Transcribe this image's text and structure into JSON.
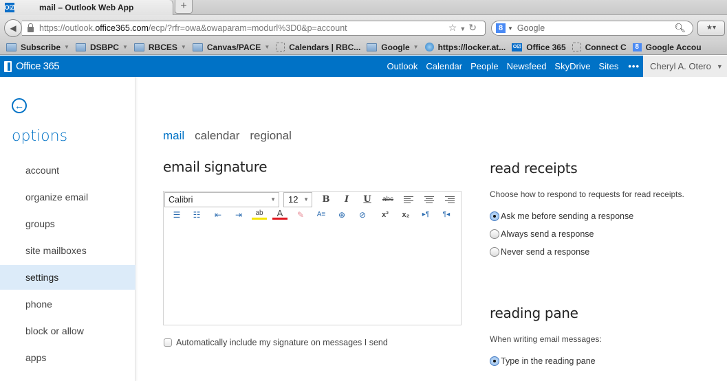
{
  "browser": {
    "tab_title": "mail – Outlook Web App",
    "tab_favicon": "O☑",
    "new_tab": "+",
    "url_prefix": "https://outlook.",
    "url_domain": "office365.com",
    "url_suffix": "/ecp/?rfr=owa&owaparam=modurl%3D0&p=account",
    "search_placeholder": "Google",
    "bookmarks": [
      {
        "label": "Subscribe",
        "icon": "folder-icon",
        "dropdown": true
      },
      {
        "label": "DSBPC",
        "icon": "folder-icon",
        "dropdown": true
      },
      {
        "label": "RBCES",
        "icon": "folder-icon",
        "dropdown": true
      },
      {
        "label": "Canvas/PACE",
        "icon": "folder-icon",
        "dropdown": true
      },
      {
        "label": "Calendars | RBC...",
        "icon": "page-icon",
        "dropdown": false
      },
      {
        "label": "Google",
        "icon": "folder-icon",
        "dropdown": true
      },
      {
        "label": "https://locker.at...",
        "icon": "att-globe-icon",
        "dropdown": false
      },
      {
        "label": "Office 365",
        "icon": "outlook-icon",
        "dropdown": false
      },
      {
        "label": "Connect C",
        "icon": "page-icon",
        "dropdown": false
      },
      {
        "label": "Google Accou",
        "icon": "google-icon",
        "dropdown": false
      }
    ]
  },
  "header": {
    "brand": "Office 365",
    "nav": [
      "Outlook",
      "Calendar",
      "People",
      "Newsfeed",
      "SkyDrive",
      "Sites"
    ],
    "more": "•••",
    "user": "Cheryl A. Otero"
  },
  "sidebar": {
    "title": "options",
    "items": [
      {
        "label": "account",
        "active": false
      },
      {
        "label": "organize email",
        "active": false
      },
      {
        "label": "groups",
        "active": false
      },
      {
        "label": "site mailboxes",
        "active": false
      },
      {
        "label": "settings",
        "active": true
      },
      {
        "label": "phone",
        "active": false
      },
      {
        "label": "block or allow",
        "active": false
      },
      {
        "label": "apps",
        "active": false
      }
    ]
  },
  "main": {
    "tabs": [
      {
        "label": "mail",
        "active": true
      },
      {
        "label": "calendar",
        "active": false
      },
      {
        "label": "regional",
        "active": false
      }
    ],
    "signature": {
      "title": "email signature",
      "font": "Calibri",
      "size": "12",
      "toolbar_row1": [
        "bold",
        "italic",
        "underline",
        "strikethrough",
        "align-left",
        "align-center",
        "align-right"
      ],
      "toolbar_row2": [
        "bullets",
        "numbering",
        "decrease-indent",
        "increase-indent",
        "highlight",
        "font-color",
        "clear-formatting",
        "line-spacing",
        "insert-link",
        "remove-link",
        "superscript",
        "subscript",
        "ltr",
        "rtl"
      ],
      "body": "",
      "auto_include_label": "Automatically include my signature on messages I send",
      "auto_include_checked": false
    },
    "read_receipts": {
      "title": "read receipts",
      "description": "Choose how to respond to requests for read receipts.",
      "options": [
        {
          "label": "Ask me before sending a response",
          "selected": true
        },
        {
          "label": "Always send a response",
          "selected": false
        },
        {
          "label": "Never send a response",
          "selected": false
        }
      ]
    },
    "reading_pane": {
      "title": "reading pane",
      "description": "When writing email messages:",
      "options": [
        {
          "label": "Type in the reading pane",
          "selected": true
        }
      ]
    }
  }
}
